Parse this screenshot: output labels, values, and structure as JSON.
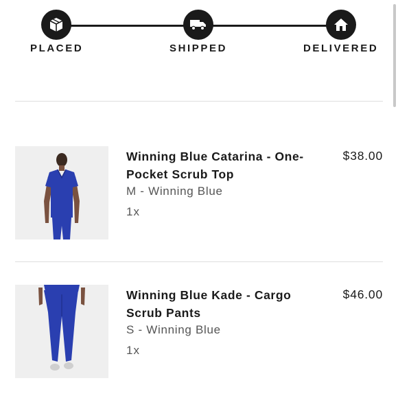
{
  "tracker": {
    "steps": [
      {
        "label": "PLACED",
        "icon": "box-icon"
      },
      {
        "label": "SHIPPED",
        "icon": "truck-icon"
      },
      {
        "label": "DELIVERED",
        "icon": "home-icon"
      }
    ]
  },
  "items": [
    {
      "name": "Winning Blue Catarina - One-Pocket Scrub Top",
      "variant": "M - Winning Blue",
      "quantity": "1x",
      "price": "$38.00",
      "image": "scrub-top-image"
    },
    {
      "name": "Winning Blue Kade - Cargo Scrub Pants",
      "variant": "S - Winning Blue",
      "quantity": "1x",
      "price": "$46.00",
      "image": "scrub-pants-image"
    }
  ],
  "colors": {
    "accent": "#1a1a1a",
    "scrub_blue": "#2a3fb0",
    "divider": "#dedede"
  }
}
